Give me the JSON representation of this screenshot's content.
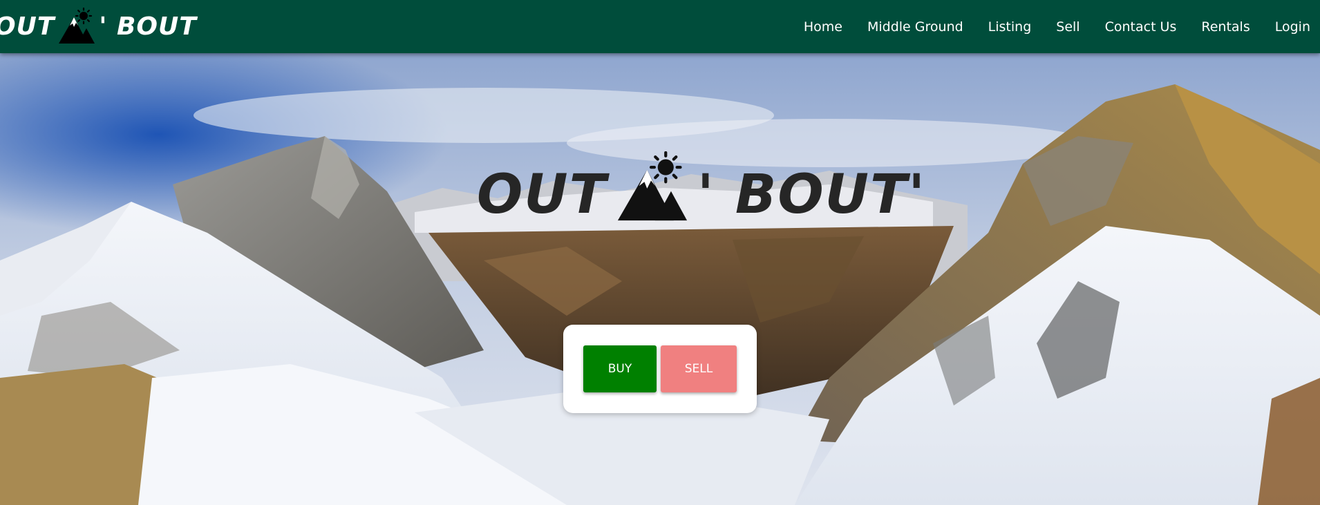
{
  "brand": {
    "name": "Out 'N' Bout",
    "left": "Out",
    "right": "' Bout",
    "logo_icon": "mountain-sun-icon"
  },
  "nav": {
    "items": [
      {
        "label": "Home"
      },
      {
        "label": "Middle Ground"
      },
      {
        "label": "Listing"
      },
      {
        "label": "Sell"
      },
      {
        "label": "Contact Us"
      },
      {
        "label": "Rentals"
      },
      {
        "label": "Login"
      }
    ]
  },
  "hero": {
    "title_left": "Out",
    "title_right": "' Bout'",
    "logo_icon": "mountain-sun-icon",
    "background": "snowy-mountain-valley-panorama"
  },
  "actions": {
    "buy_label": "BUY",
    "sell_label": "SELL"
  },
  "colors": {
    "nav_bg": "#004d3b",
    "buy": "#008000",
    "sell": "#f08080",
    "title_text": "#262626"
  }
}
